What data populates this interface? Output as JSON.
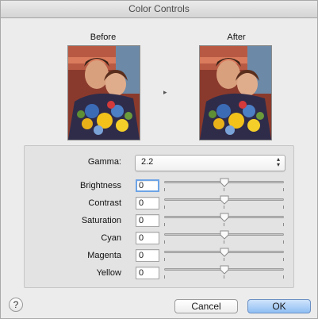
{
  "window": {
    "title": "Color Controls"
  },
  "preview": {
    "before_label": "Before",
    "after_label": "After",
    "arrow_glyph": "▸"
  },
  "gamma": {
    "label": "Gamma:",
    "value": "2.2"
  },
  "adjustments": [
    {
      "label": "Brightness",
      "value": "0",
      "level": 0.5
    },
    {
      "label": "Contrast",
      "value": "0",
      "level": 0.5
    },
    {
      "label": "Saturation",
      "value": "0",
      "level": 0.5
    },
    {
      "label": "Cyan",
      "value": "0",
      "level": 0.5
    },
    {
      "label": "Magenta",
      "value": "0",
      "level": 0.5
    },
    {
      "label": "Yellow",
      "value": "0",
      "level": 0.5
    }
  ],
  "buttons": {
    "help": "?",
    "cancel": "Cancel",
    "ok": "OK"
  },
  "colors": {
    "ok_button": "#8fbef3",
    "focus_ring": "#6da4e6",
    "window_bg": "#ececec"
  }
}
